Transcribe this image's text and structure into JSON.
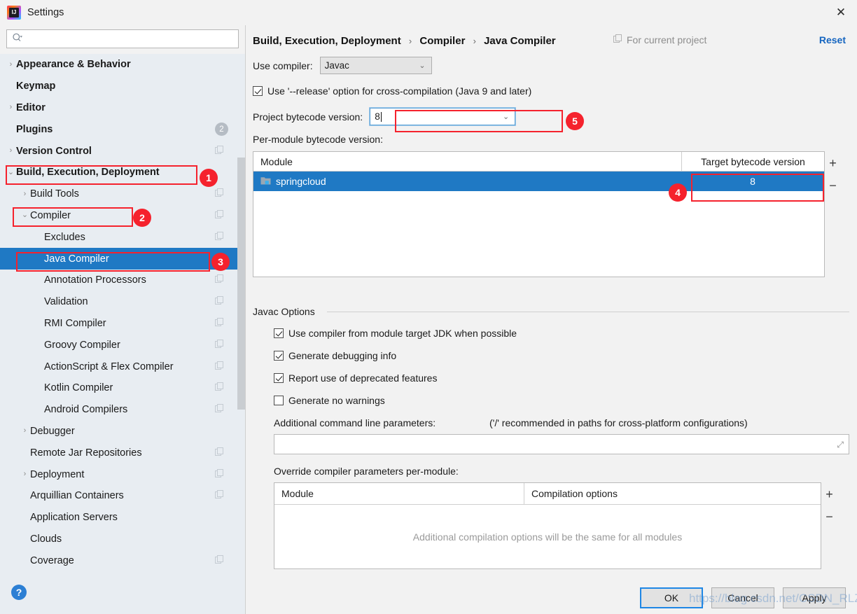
{
  "window": {
    "title": "Settings",
    "app_icon": "intellij-idea-logo",
    "close_icon": "✕"
  },
  "sidebar": {
    "search": {
      "placeholder": "",
      "value": "",
      "icon": "search-icon"
    },
    "items": [
      {
        "label": "Appearance & Behavior",
        "arrow": "›",
        "indent": 0,
        "bold": true,
        "copy": false,
        "badge": null,
        "selected": false
      },
      {
        "label": "Keymap",
        "arrow": "",
        "indent": 0,
        "bold": true,
        "copy": false,
        "badge": null,
        "selected": false
      },
      {
        "label": "Editor",
        "arrow": "›",
        "indent": 0,
        "bold": true,
        "copy": false,
        "badge": null,
        "selected": false
      },
      {
        "label": "Plugins",
        "arrow": "",
        "indent": 0,
        "bold": true,
        "copy": false,
        "badge": "2",
        "selected": false
      },
      {
        "label": "Version Control",
        "arrow": "›",
        "indent": 0,
        "bold": true,
        "copy": true,
        "badge": null,
        "selected": false
      },
      {
        "label": "Build, Execution, Deployment",
        "arrow": "⌄",
        "indent": 0,
        "bold": true,
        "copy": false,
        "badge": null,
        "selected": false
      },
      {
        "label": "Build Tools",
        "arrow": "›",
        "indent": 1,
        "bold": false,
        "copy": true,
        "badge": null,
        "selected": false
      },
      {
        "label": "Compiler",
        "arrow": "⌄",
        "indent": 1,
        "bold": false,
        "copy": true,
        "badge": null,
        "selected": false
      },
      {
        "label": "Excludes",
        "arrow": "",
        "indent": 2,
        "bold": false,
        "copy": true,
        "badge": null,
        "selected": false
      },
      {
        "label": "Java Compiler",
        "arrow": "",
        "indent": 2,
        "bold": false,
        "copy": false,
        "badge": null,
        "selected": true
      },
      {
        "label": "Annotation Processors",
        "arrow": "",
        "indent": 2,
        "bold": false,
        "copy": true,
        "badge": null,
        "selected": false
      },
      {
        "label": "Validation",
        "arrow": "",
        "indent": 2,
        "bold": false,
        "copy": true,
        "badge": null,
        "selected": false
      },
      {
        "label": "RMI Compiler",
        "arrow": "",
        "indent": 2,
        "bold": false,
        "copy": true,
        "badge": null,
        "selected": false
      },
      {
        "label": "Groovy Compiler",
        "arrow": "",
        "indent": 2,
        "bold": false,
        "copy": true,
        "badge": null,
        "selected": false
      },
      {
        "label": "ActionScript & Flex Compiler",
        "arrow": "",
        "indent": 2,
        "bold": false,
        "copy": true,
        "badge": null,
        "selected": false
      },
      {
        "label": "Kotlin Compiler",
        "arrow": "",
        "indent": 2,
        "bold": false,
        "copy": true,
        "badge": null,
        "selected": false
      },
      {
        "label": "Android Compilers",
        "arrow": "",
        "indent": 2,
        "bold": false,
        "copy": true,
        "badge": null,
        "selected": false
      },
      {
        "label": "Debugger",
        "arrow": "›",
        "indent": 1,
        "bold": false,
        "copy": false,
        "badge": null,
        "selected": false
      },
      {
        "label": "Remote Jar Repositories",
        "arrow": "",
        "indent": 1,
        "bold": false,
        "copy": true,
        "badge": null,
        "selected": false
      },
      {
        "label": "Deployment",
        "arrow": "›",
        "indent": 1,
        "bold": false,
        "copy": true,
        "badge": null,
        "selected": false
      },
      {
        "label": "Arquillian Containers",
        "arrow": "",
        "indent": 1,
        "bold": false,
        "copy": true,
        "badge": null,
        "selected": false
      },
      {
        "label": "Application Servers",
        "arrow": "",
        "indent": 1,
        "bold": false,
        "copy": false,
        "badge": null,
        "selected": false
      },
      {
        "label": "Clouds",
        "arrow": "",
        "indent": 1,
        "bold": false,
        "copy": false,
        "badge": null,
        "selected": false
      },
      {
        "label": "Coverage",
        "arrow": "",
        "indent": 1,
        "bold": false,
        "copy": true,
        "badge": null,
        "selected": false
      }
    ],
    "help_button": "?"
  },
  "header": {
    "breadcrumb": [
      "Build, Execution, Deployment",
      "Compiler",
      "Java Compiler"
    ],
    "separator": "›",
    "for_project": "For current project",
    "for_project_icon": "copy-icon",
    "reset": "Reset",
    "reset_color": "#1565c0"
  },
  "main": {
    "use_compiler_label": "Use compiler:",
    "use_compiler_value": "Javac",
    "release_option_label": "Use '--release' option for cross-compilation (Java 9 and later)",
    "release_option_checked": true,
    "project_bytecode_label": "Project bytecode version:",
    "project_bytecode_value": "8",
    "per_module_label": "Per-module bytecode version:",
    "module_table": {
      "columns": [
        "Module",
        "Target bytecode version"
      ],
      "rows": [
        {
          "module": "springcloud",
          "version": "8",
          "icon": "module-folder-icon",
          "selected": true
        }
      ],
      "add_button": "+",
      "remove_button": "−"
    },
    "javac_options": {
      "legend": "Javac Options",
      "checkboxes": [
        {
          "label": "Use compiler from module target JDK when possible",
          "checked": true
        },
        {
          "label": "Generate debugging info",
          "checked": true
        },
        {
          "label": "Report use of deprecated features",
          "checked": true
        },
        {
          "label": "Generate no warnings",
          "checked": false
        }
      ],
      "additional_params_label": "Additional command line parameters:",
      "additional_params_hint": "('/' recommended in paths for cross-platform configurations)",
      "additional_params_value": "",
      "expand_icon": "expand-icon",
      "override_label": "Override compiler parameters per-module:",
      "override_table": {
        "columns": [
          "Module",
          "Compilation options"
        ],
        "empty_text": "Additional compilation options will be the same for all modules",
        "add_button": "+",
        "remove_button": "−"
      }
    }
  },
  "buttons": {
    "ok": "OK",
    "cancel": "Cancel",
    "apply": "Apply"
  },
  "annotations": [
    {
      "number": "1",
      "target": "sidebar-item-build-execution-deployment"
    },
    {
      "number": "2",
      "target": "sidebar-item-compiler"
    },
    {
      "number": "3",
      "target": "sidebar-item-java-compiler"
    },
    {
      "number": "4",
      "target": "module-target-bytecode-cell"
    },
    {
      "number": "5",
      "target": "project-bytecode-combo"
    }
  ],
  "watermark": "https://blog.csdn.net/CSDN_RLZ"
}
